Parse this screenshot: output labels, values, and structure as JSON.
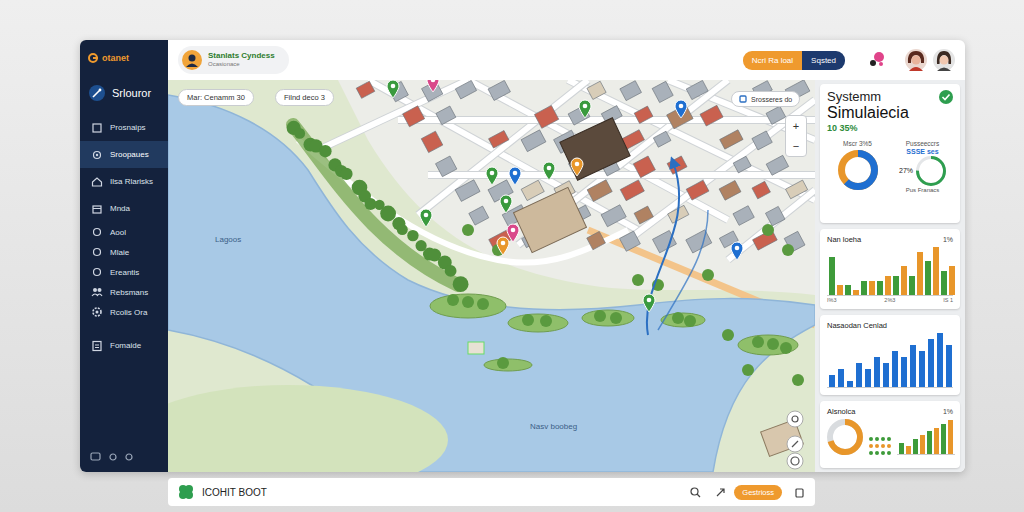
{
  "app": {
    "logo": "otanet",
    "title": "Srlouror"
  },
  "sidebar": {
    "items": [
      {
        "label": "Prosnaips",
        "selected": false
      },
      {
        "label": "Sroopaues",
        "selected": true
      },
      {
        "label": "Ilsa Rlarisks",
        "selected": false
      },
      {
        "label": "Mnda",
        "selected": false
      },
      {
        "label": "Aool",
        "selected": false
      },
      {
        "label": "Mlaie",
        "selected": false
      },
      {
        "label": "Ereantis",
        "selected": false
      },
      {
        "label": "Rebsmans",
        "selected": false
      },
      {
        "label": "Rcolis Ora",
        "selected": false
      },
      {
        "label": "Fomaide",
        "selected": false
      }
    ]
  },
  "topbar": {
    "profile": {
      "name": "Stanlats Cyndess",
      "subtitle": "Ocasionace"
    },
    "buttons": [
      {
        "label": "Ncri Ra loal",
        "color": "#ef9a2e"
      },
      {
        "label": "Sqsted",
        "color": "#1d3a6e"
      }
    ]
  },
  "map": {
    "chips": [
      "Mar: Cenamm 30",
      "Filnd deco 3"
    ],
    "layer_chip": "Srosseres do",
    "labels": [
      "Lagoos",
      "Nasv boobeg"
    ],
    "zoom": [
      "+",
      "−"
    ],
    "pins": [
      {
        "color": "#3a9a3e"
      },
      {
        "color": "#d9488a"
      },
      {
        "color": "#3a9a3e"
      },
      {
        "color": "#1f6fd1"
      },
      {
        "color": "#3a9a3e"
      },
      {
        "color": "#1f6fd1"
      },
      {
        "color": "#3a9a3e"
      },
      {
        "color": "#e8962a"
      },
      {
        "color": "#3a9a3e"
      },
      {
        "color": "#3a9a3e"
      },
      {
        "color": "#d9488a"
      },
      {
        "color": "#e8962a"
      },
      {
        "color": "#1f6fd1"
      },
      {
        "color": "#3a9a3e"
      }
    ]
  },
  "panels": {
    "system": {
      "title": "Systemm",
      "subtitle": "Simulaiecia",
      "value": "10 35%",
      "left_label": "Mscr 3%5",
      "left_donut": {
        "level": 0.62
      },
      "right_label": "Pusseeccrs",
      "right_value": "SSSE ses",
      "right_pct": "27%",
      "right_donut": {
        "level": 0.75
      },
      "right_caption": "Pus Franacs"
    },
    "activity": {
      "title": "Nan loeha",
      "badge": "1%",
      "series": [
        {
          "color": "#3e9b3a",
          "values": [
            8,
            2,
            3,
            3,
            4,
            4,
            7,
            5
          ]
        },
        {
          "color": "#e8962a",
          "values": [
            2,
            1,
            3,
            4,
            6,
            9,
            10,
            6
          ]
        }
      ],
      "ticks": [
        "I%3",
        "2%3",
        "IS 1"
      ]
    },
    "trend": {
      "title": "Nasaodan Cenlad",
      "series": [
        {
          "color": "#1f6fd1",
          "values": [
            2,
            3,
            1,
            4,
            3,
            5,
            4,
            6,
            5,
            7,
            6,
            8,
            9,
            7
          ]
        }
      ]
    },
    "summary": {
      "title": "Alsnolca",
      "badge": "1%",
      "donut": {
        "level": 0.7
      },
      "series": [
        {
          "color": "#3e9b3a",
          "values": [
            3,
            4,
            6,
            8
          ]
        },
        {
          "color": "#e8962a",
          "values": [
            2,
            5,
            7,
            9
          ]
        }
      ]
    }
  },
  "bottom_bar": {
    "brand": "ICOHIT BOOT",
    "button": "Gestrioss"
  }
}
